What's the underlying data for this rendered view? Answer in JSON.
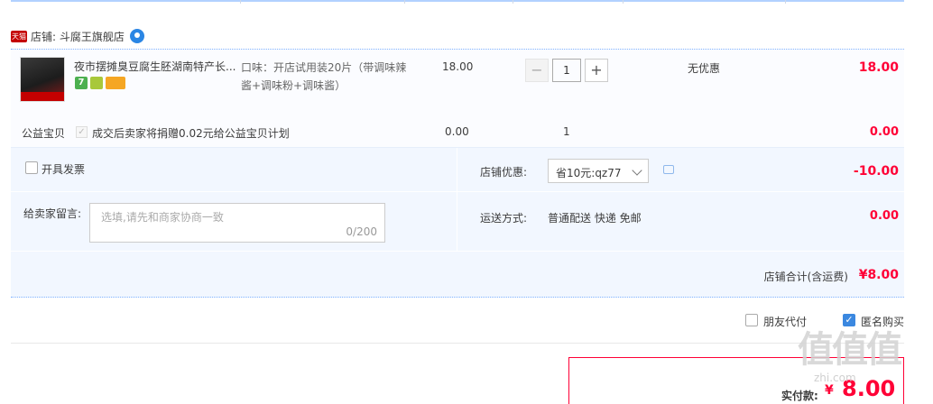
{
  "shop": {
    "badge": "天猫",
    "label": "店铺: 斗腐王旗舰店"
  },
  "item": {
    "title": "夜市摆摊臭豆腐生胚湖南特产长...",
    "service_7_label": "7",
    "sku": "口味：开店试用装20片（带调味辣酱+调味粉+调味酱）",
    "price": "18.00",
    "quantity": "1",
    "promo": "无优惠",
    "subtotal": "18.00",
    "service_icons": [
      "seven-day-return-icon",
      "guarantee-icon",
      "card-payment-icon"
    ]
  },
  "charity": {
    "label": "公益宝贝",
    "text": "成交后卖家将捐赠0.02元给公益宝贝计划",
    "price": "0.00",
    "quantity": "1",
    "subtotal": "0.00"
  },
  "options": {
    "invoice_label": "开具发票",
    "message_label": "给卖家留言:",
    "message_placeholder": "选填,请先和商家协商一致",
    "message_count": "0/200",
    "shop_discount_label": "店铺优惠:",
    "coupon_value": "省10元:qz77",
    "discount_amount": "-10.00",
    "shipping_label": "运送方式:",
    "shipping_value": "普通配送 快递 免邮",
    "shipping_amount": "0.00"
  },
  "shop_total": {
    "label": "店铺合计(含运费)",
    "value": "¥8.00"
  },
  "checkout": {
    "friend_pay_label": "朋友代付",
    "friend_pay_checked": false,
    "anonymous_label": "匿名购买",
    "anonymous_checked": true,
    "pay_label": "实付款:",
    "pay_currency": "¥",
    "pay_value": "8.00"
  },
  "watermark": {
    "main": "值值值",
    "sub": "zhi.com"
  },
  "colors": {
    "price_red": "#ff0036",
    "accent_blue": "#3b88e0",
    "panel_bg": "#f2f7ff"
  }
}
